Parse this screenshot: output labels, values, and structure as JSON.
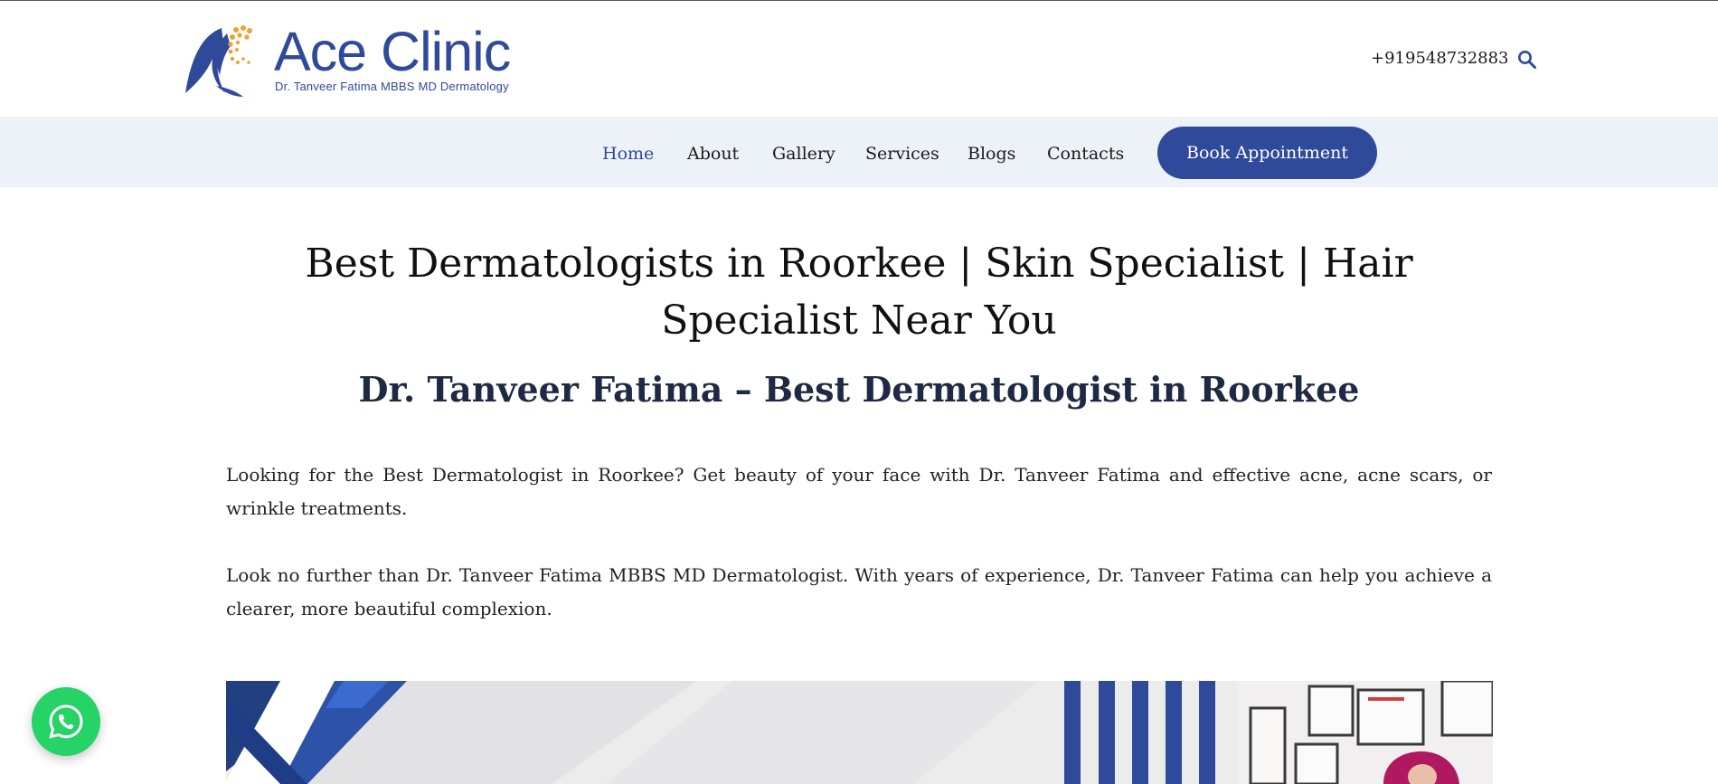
{
  "brand": {
    "name": "Ace Clinic",
    "tagline": "Dr. Tanveer Fatima MBBS MD Dermatology",
    "primary_color": "#2f4a9a",
    "accent_color": "#f0a030"
  },
  "header": {
    "phone": "+919548732883",
    "search_icon": "search-icon"
  },
  "nav": {
    "items": [
      {
        "label": "Home",
        "active": true
      },
      {
        "label": "About",
        "active": false
      },
      {
        "label": "Gallery",
        "active": false
      },
      {
        "label": "Services",
        "active": false
      },
      {
        "label": "Blogs",
        "active": false
      },
      {
        "label": "Contacts",
        "active": false
      }
    ],
    "cta_label": "Book Appointment"
  },
  "main": {
    "title": "Best Dermatologists in Roorkee | Skin Specialist | Hair Specialist Near You",
    "subtitle": "Dr. Tanveer Fatima – Best Dermatologist in Roorkee",
    "paragraphs": [
      "Looking for the Best Dermatologist in Roorkee? Get beauty of your face with Dr. Tanveer Fatima and effective acne, acne scars, or wrinkle treatments.",
      "Look no further than Dr. Tanveer Fatima MBBS MD Dermatologist. With years of experience, Dr. Tanveer Fatima can help you achieve a clearer, more beautiful complexion."
    ]
  },
  "floating": {
    "whatsapp_icon": "whatsapp-icon",
    "whatsapp_color": "#25d366"
  }
}
